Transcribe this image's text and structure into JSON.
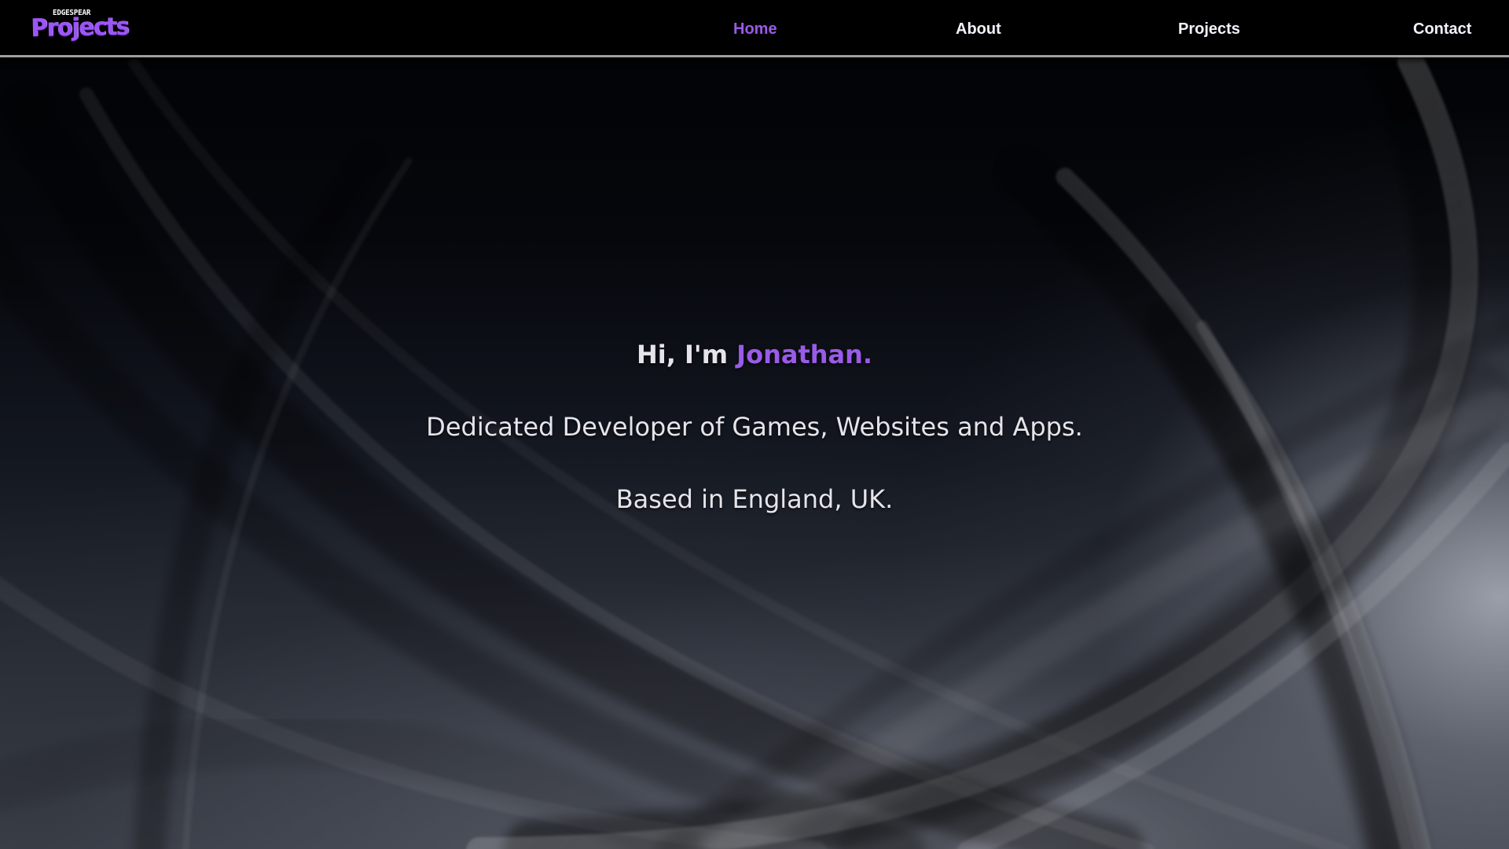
{
  "header": {
    "logo": {
      "small_text": "EDGESPEAR",
      "main_text": "Projects"
    },
    "nav": {
      "home": "Home",
      "about": "About",
      "projects": "Projects",
      "contact": "Contact",
      "active": "Home"
    }
  },
  "hero": {
    "greeting_prefix": "Hi, I'm ",
    "name": "Jonathan.",
    "description": "Dedicated Developer of Games, Websites and Apps.",
    "location": "Based in England, UK."
  },
  "colors": {
    "accent": "#9a5be8",
    "header_background": "#000000",
    "text": "#e4e4ea"
  }
}
